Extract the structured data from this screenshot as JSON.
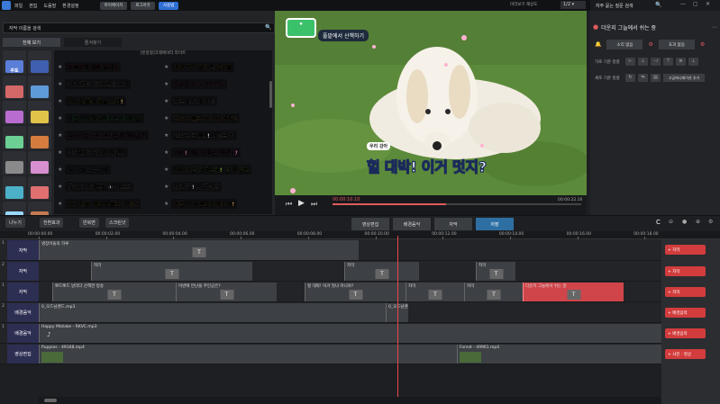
{
  "menubar": {
    "menus": [
      "파일",
      "편집",
      "도움말",
      "환경설정"
    ],
    "buttons": [
      "아이에이치",
      "로그아웃",
      "사용법"
    ]
  },
  "preview": {
    "mode_label": "미리보기 해상도",
    "ratio": "1/2"
  },
  "search": {
    "placeholder": "자막 이름을 검색"
  },
  "tabs": [
    "전체 보기",
    "즐겨찾기"
  ],
  "list_header": "[빈방형]크레에이터 라이트",
  "thumbs": [
    {
      "label": "주토",
      "color": "#5b7ed8"
    },
    {
      "label": "",
      "color": "#3f5fb0"
    },
    {
      "label": "",
      "color": "#d46868"
    },
    {
      "label": "",
      "color": "#5f9ad8"
    },
    {
      "label": "",
      "color": "#b86cd0"
    },
    {
      "label": "",
      "color": "#e2c34a"
    },
    {
      "label": "",
      "color": "#6ccf93"
    },
    {
      "label": "",
      "color": "#d47d3f"
    },
    {
      "label": "",
      "color": "#8a8a8a"
    },
    {
      "label": "",
      "color": "#d88fcf"
    },
    {
      "label": "",
      "color": "#4cb0c8"
    },
    {
      "label": "",
      "color": "#e07070"
    },
    {
      "label": "",
      "color": "#9ad8ff"
    },
    {
      "label": "",
      "color": "#c47a53"
    }
  ],
  "thumb_captions": [
    "",
    "",
    "",
    "",
    "",
    "",
    "",
    "",
    "",
    "",
    "",
    "",
    "",
    ""
  ],
  "titles_left": [
    {
      "text": "주독주이 여행 우리리",
      "color": "#ff5b6e"
    },
    {
      "text": "내고 동영 오현 편디 꼬리",
      "color": "#ffffff"
    },
    {
      "text": "아니 만들어 몸을 느낌!",
      "color": "#ffe16b"
    },
    {
      "text": "지금 이어이 되어보는 인리진열",
      "color": "#6eff9b"
    },
    {
      "text": "나가 지금부터 크라운서 이리벌어",
      "color": "#ff8fe1"
    },
    {
      "text": "이 라디오 시시 이해진다",
      "color": "#ffffff"
    },
    {
      "text": "나가 최고 누구와",
      "color": "#8ed6ff"
    },
    {
      "text": "구드지 머리분들 ① 어트트",
      "color": "#ffffff"
    },
    {
      "text": "사고 다른 새로 만들는 것이다",
      "color": "#ffd36b"
    }
  ],
  "titles_right": [
    {
      "text": "괴장 정이 많으면 결과물",
      "color": "#ffd36b"
    },
    {
      "text": "이유로 오다 그러하니",
      "color": "#ff7bd5"
    },
    {
      "text": "마는 만드니 좋이",
      "color": "#ffffff"
    },
    {
      "text": "반도로 빠르 추고 대성라만",
      "color": "#ffe16b"
    },
    {
      "text": "민드로 남려다! 다하는 정",
      "color": "#ffffff"
    },
    {
      "text": "대박! 이렇게 좋은 아닌대?",
      "color": "#ff8fe1"
    },
    {
      "text": "아니 조금 남겼는데! 한 찍 같은",
      "color": "#b6ff6b"
    },
    {
      "text": "바로 끝! 이 주세요",
      "color": "#ffffff"
    },
    {
      "text": "지금 이게 괜찮게 해보자!",
      "color": "#ffd36b"
    }
  ],
  "video": {
    "caption_top": "풀밭에서 산책하기",
    "caption_bottom_small": "우리 강아",
    "caption_bottom": "헐 대박! 이거 멋지?",
    "time_current": "00:00:10.10",
    "time_total": "00:00:22.16"
  },
  "rightpanel": {
    "search_label": "자주 묻는 질문 검색",
    "title": "더운지 그늘에서 쉬는 중",
    "sound_label": "소리 없음",
    "effect_label": "효과 없음",
    "row1_label": "가로 기준 정렬",
    "row2_label": "세로 기준 정렬",
    "advanced_label": "고급애니메이션 추가"
  },
  "bottombar": {
    "buttons": [
      "나누기",
      "전환효과",
      "반복변",
      "스크린샷"
    ],
    "center_tabs": [
      "영상편집",
      "배경음악",
      "자막",
      "저장"
    ],
    "active_tab": 3
  },
  "ruler": [
    "00:00:00.00",
    "00:00:02.00",
    "00:00:04.00",
    "00:00:06.00",
    "00:00:08.00",
    "00:00:10.00",
    "00:00:12.00",
    "00:00:14.00",
    "00:00:16.00",
    "00:00:18.00"
  ],
  "tracks": [
    {
      "num": "1",
      "label": "자막"
    },
    {
      "num": "2",
      "label": "자막"
    },
    {
      "num": "1",
      "label": "자막"
    },
    {
      "num": "2",
      "label": "배경음악"
    },
    {
      "num": "1",
      "label": "배경음악"
    },
    {
      "num": "",
      "label": "영상편집"
    }
  ],
  "clips": {
    "t1": [
      {
        "label": "냉장이들의 하루"
      }
    ],
    "t2": [
      {
        "label": "자막"
      },
      {
        "label": "자막"
      },
      {
        "label": "자막"
      }
    ],
    "t3": [
      {
        "label": "뽀드뽀드 날리다 산책한 방송"
      },
      {
        "label": "이번에 만난을 주인공은?"
      },
      {
        "label": "헐 대박! 이거 멋냐 아니야?"
      },
      {
        "label": "자막"
      },
      {
        "label": "자막"
      },
      {
        "label": "더운지 그늘에서 쉬는 중"
      }
    ],
    "t4": [
      {
        "label": "0_오드님랜드.mp3"
      },
      {
        "label": "0_오드님랜드2.flac"
      }
    ],
    "t5": [
      {
        "label": "Happy Mistake - RKVC.mp3"
      }
    ],
    "t6": [
      {
        "label": "Puppies - 49168.mp4"
      },
      {
        "label": "Forest - 49961.mp4"
      }
    ]
  },
  "add_buttons": [
    "+ 자막",
    "+ 자막",
    "+ 자막",
    "+ 배경음악",
    "+ 배경음악",
    "+ 사진 · 영상"
  ]
}
